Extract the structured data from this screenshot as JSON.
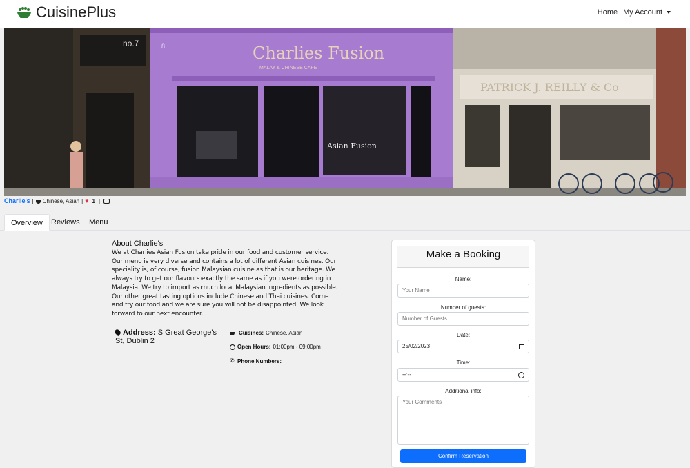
{
  "navbar": {
    "brand": "CuisinePlus",
    "links": {
      "home": "Home",
      "account": "My Account"
    }
  },
  "hero": {
    "sign_main": "Charlies Fusion",
    "sign_sub": "MALAY & CHINESE CAFE",
    "shop_number": "no.7",
    "door_number": "8",
    "neighbour_sign": "PATRICK J. REILLY & Co",
    "window_text": "Asian Fusion"
  },
  "restaurant": {
    "name": "Charlie's",
    "cuisines_short": "Chinese, Asian",
    "likes": "1"
  },
  "tabs": {
    "overview": "Overview",
    "reviews": "Reviews",
    "menu": "Menu"
  },
  "about": {
    "title": "About Charlie's",
    "text": "We at Charlies Asian Fusion take pride in our food and customer service. Our menu is very diverse and contains a lot of different Asian cuisines. Our speciality is, of course, fusion Malaysian cuisine as that is our heritage. We always try to get our flavours exactly the same as if you were ordering in Malaysia. We try to import as much local Malaysian ingredients as possible. Our other great tasting options include Chinese and Thai cuisines. Come and try our food and we are sure you will not be disappointed. We look forward to our next encounter."
  },
  "address": {
    "label": "Address:",
    "value": "S Great George's St, Dublin 2"
  },
  "details": {
    "cuisines_label": "Cuisines:",
    "cuisines_value": "Chinese, Asian",
    "hours_label": "Open Hours:",
    "hours_value": "01:00pm - 09:00pm",
    "phone_label": "Phone Numbers:"
  },
  "booking": {
    "title": "Make a Booking",
    "name_label": "Name:",
    "name_placeholder": "Your Name",
    "guests_label": "Number of guests:",
    "guests_placeholder": "Number of Guests",
    "date_label": "Date:",
    "date_value": "25/02/2023",
    "time_label": "Time:",
    "time_value": "--:--",
    "info_label": "Additional info:",
    "info_placeholder": "Your Comments",
    "submit": "Confirm Reservation"
  },
  "colors": {
    "primary": "#0d6efd",
    "heart": "#dc3545",
    "storefront": "#a77bd0"
  }
}
